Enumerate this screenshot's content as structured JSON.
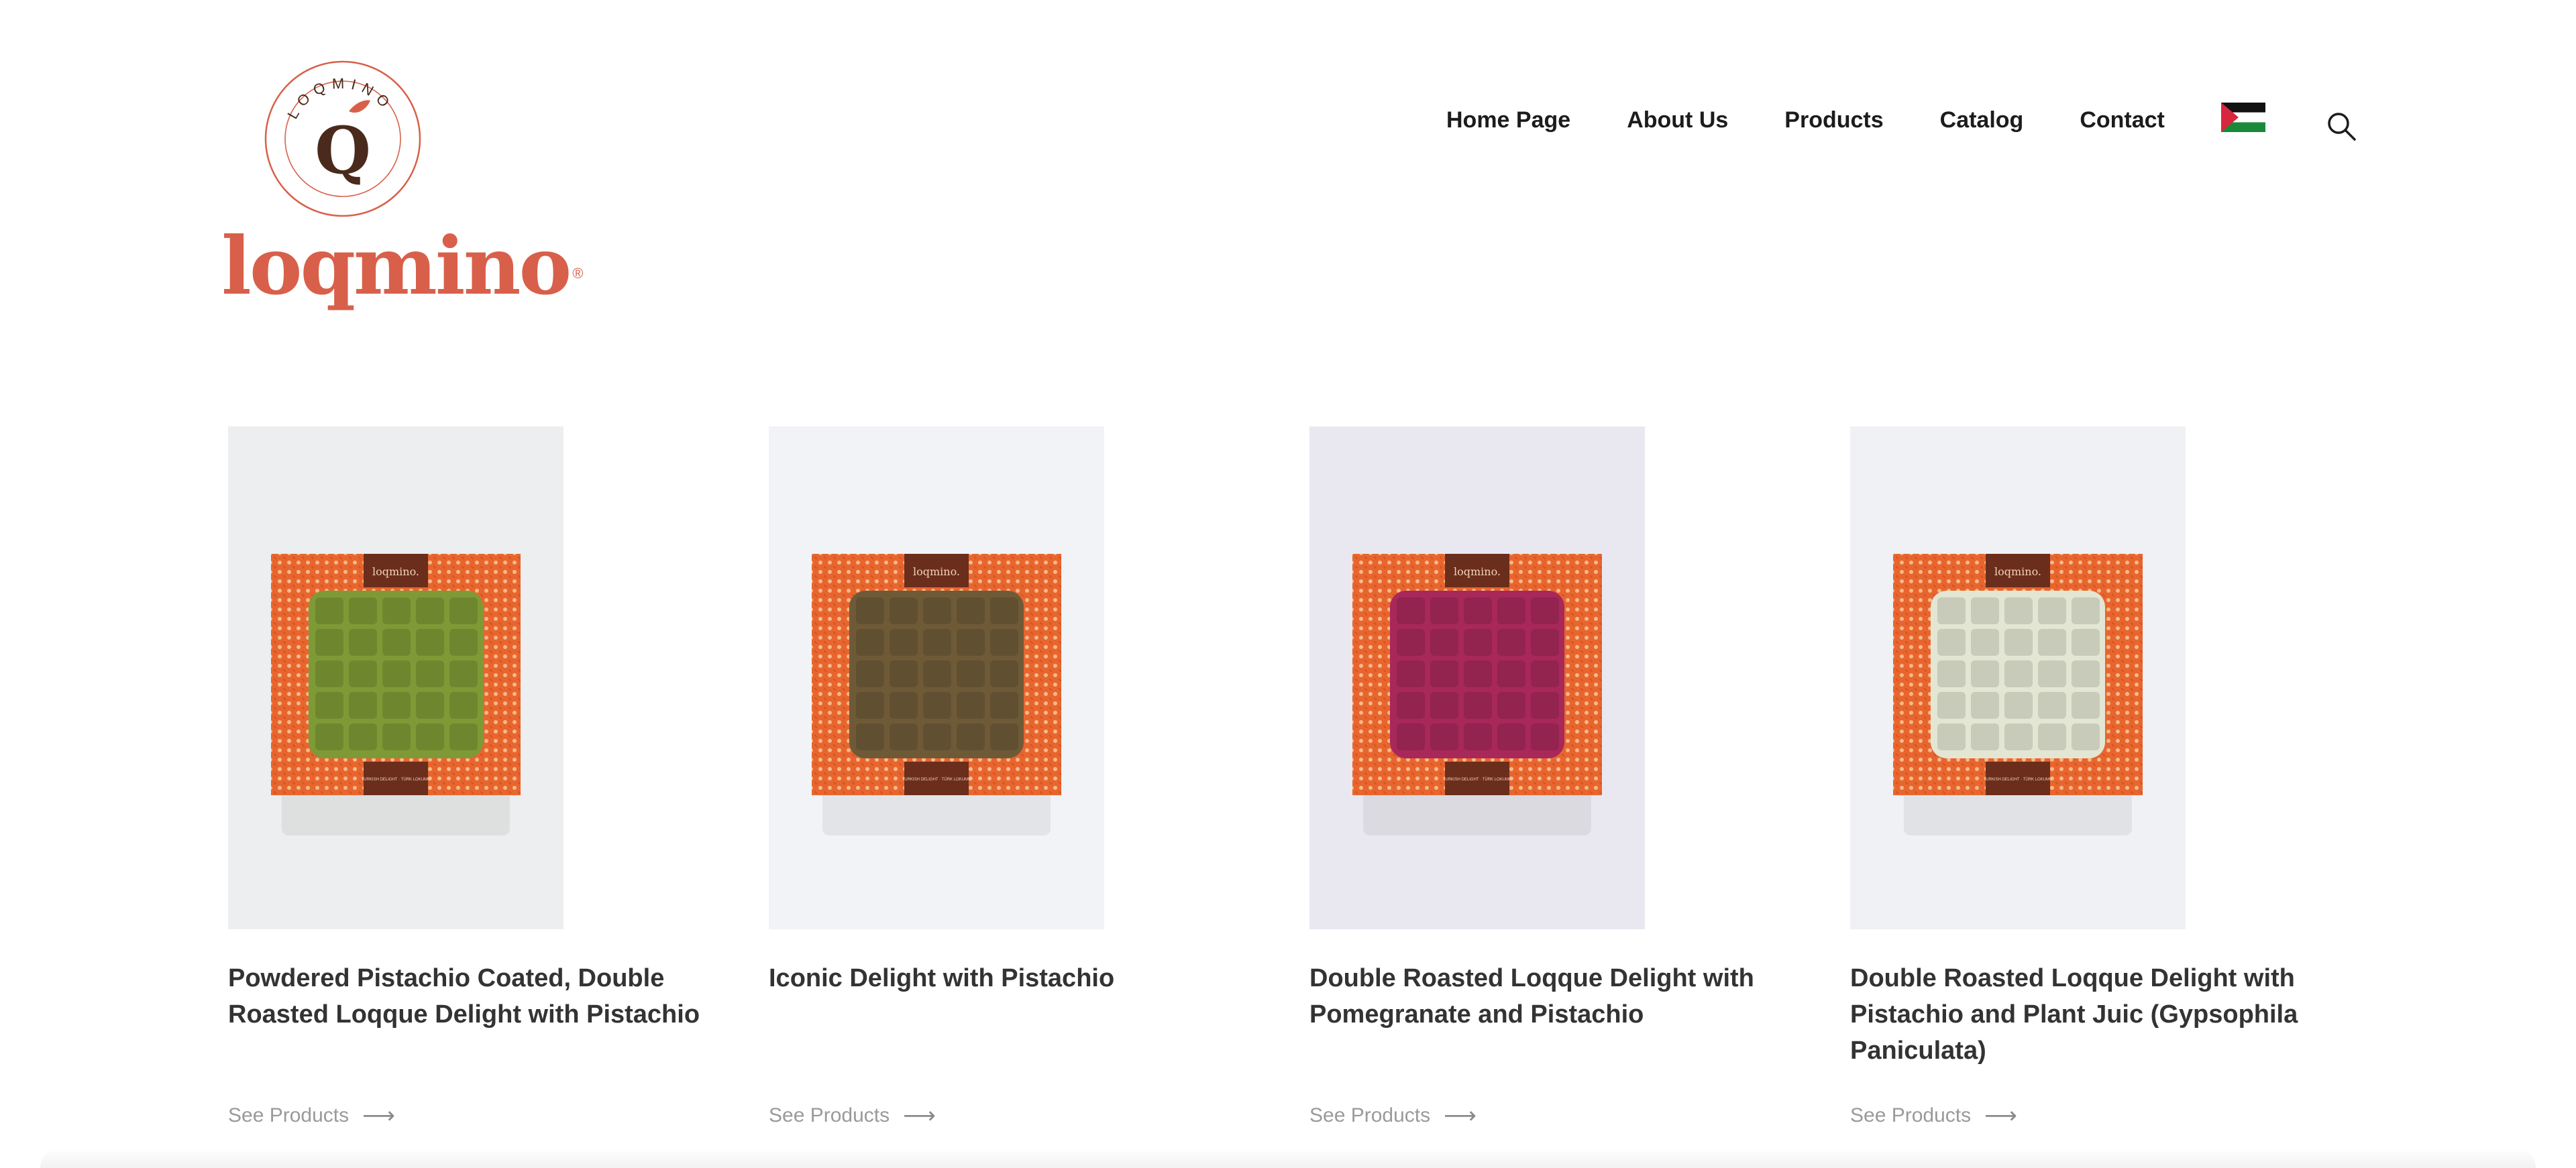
{
  "brand": {
    "name": "loqmino",
    "emblem_text": "LOQMINO",
    "emblem_letter": "Q",
    "registered": "®",
    "color_primary": "#d8604a",
    "color_dark": "#4a2a1c"
  },
  "nav": {
    "items": [
      "Home Page",
      "About Us",
      "Products",
      "Catalog",
      "Contact"
    ],
    "language_flag": "palestine-flag",
    "search_icon": "search-icon"
  },
  "products": [
    {
      "title": "Powdered Pistachio Coated, Double Roasted Loqque Delight with Pistachio",
      "link": "See Products",
      "arrow": "⟶",
      "bg": "#eceeef",
      "fill": "#7e9a36"
    },
    {
      "title": "Iconic Delight with Pistachio",
      "link": "See Products",
      "arrow": "⟶",
      "bg": "#f1f3f6",
      "fill": "#6f5a38"
    },
    {
      "title": "Double Roasted Loqque Delight with Pomegranate and Pistachio",
      "link": "See Products",
      "arrow": "⟶",
      "bg": "#e9e8f0",
      "fill": "#a8285a"
    },
    {
      "title": "Double Roasted Loqque Delight with Pistachio and Plant Juic (Gypsophila Paniculata)",
      "link": "See Products",
      "arrow": "⟶",
      "bg": "#f0f1f4",
      "fill": "#e4e6d4"
    }
  ],
  "box": {
    "label": "loqmino.",
    "footer_label": "TURKISH DELIGHT · TÜRK LOKUMU"
  }
}
